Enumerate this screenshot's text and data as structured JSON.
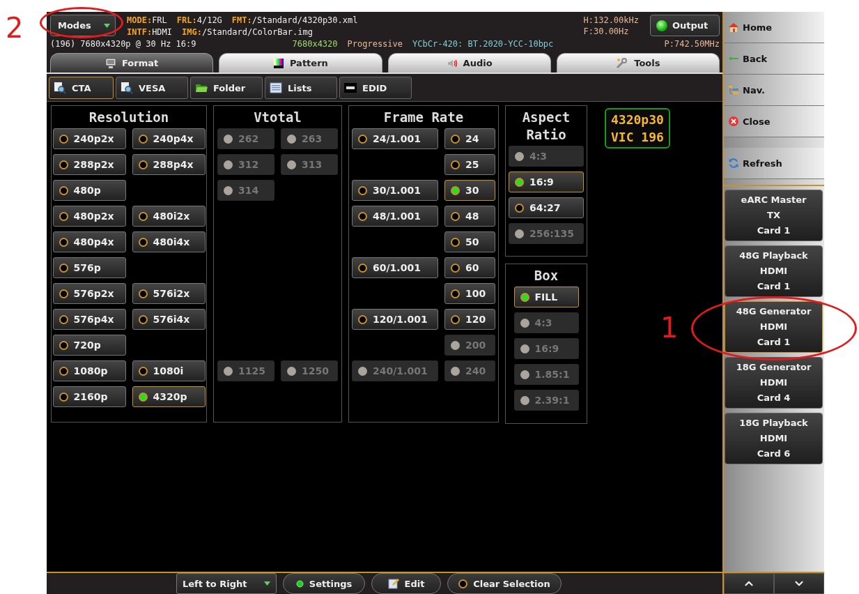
{
  "header": {
    "modes_button": "Modes",
    "info_line_1": [
      {
        "label": "MODE:",
        "value": "FRL"
      },
      {
        "label": "FRL:",
        "value": "4/12G"
      },
      {
        "label": "FMT:",
        "value": "/Standard/4320p30.xml"
      }
    ],
    "info_line_2": [
      {
        "label": "INTF:",
        "value": "HDMI"
      },
      {
        "label": "IMG:",
        "value": "/Standard/ColorBar.img"
      }
    ],
    "timing": "(196) 7680x4320p @ 30 Hz 16:9",
    "resolution": "7680x4320",
    "scan": "Progressive",
    "colorimetry": "YCbCr-420: BT.2020-YCC-10bpc",
    "h_freq": "H:132.00kHz",
    "f_rate": "F:30.00Hz",
    "pixel_clock": "P:742.50MHz",
    "output_button": {
      "label": "Output",
      "on": true
    }
  },
  "tabs": [
    {
      "label": "Format",
      "selected": true
    },
    {
      "label": "Pattern",
      "selected": false
    },
    {
      "label": "Audio",
      "selected": false
    },
    {
      "label": "Tools",
      "selected": false
    }
  ],
  "subtabs": [
    {
      "label": "CTA",
      "selected": true
    },
    {
      "label": "VESA",
      "selected": false
    },
    {
      "label": "Folder",
      "selected": false
    },
    {
      "label": "Lists",
      "selected": false
    },
    {
      "label": "EDID",
      "selected": false
    }
  ],
  "panels": [
    {
      "title": "Resolution",
      "kind": "grid",
      "rows": [
        {
          "left": {
            "label": "240p2x",
            "selected": false,
            "disabled": false
          },
          "right": {
            "label": "240p4x",
            "selected": false,
            "disabled": false
          }
        },
        {
          "left": {
            "label": "288p2x",
            "selected": false,
            "disabled": false
          },
          "right": {
            "label": "288p4x",
            "selected": false,
            "disabled": false
          }
        },
        {
          "left": {
            "label": "480p",
            "selected": false,
            "disabled": false
          }
        },
        {
          "left": {
            "label": "480p2x",
            "selected": false,
            "disabled": false
          },
          "right": {
            "label": "480i2x",
            "selected": false,
            "disabled": false
          }
        },
        {
          "left": {
            "label": "480p4x",
            "selected": false,
            "disabled": false
          },
          "right": {
            "label": "480i4x",
            "selected": false,
            "disabled": false
          }
        },
        {
          "left": {
            "label": "576p",
            "selected": false,
            "disabled": false
          }
        },
        {
          "left": {
            "label": "576p2x",
            "selected": false,
            "disabled": false
          },
          "right": {
            "label": "576i2x",
            "selected": false,
            "disabled": false
          }
        },
        {
          "left": {
            "label": "576p4x",
            "selected": false,
            "disabled": false
          },
          "right": {
            "label": "576i4x",
            "selected": false,
            "disabled": false
          }
        },
        {
          "left": {
            "label": "720p",
            "selected": false,
            "disabled": false
          }
        },
        {
          "left": {
            "label": "1080p",
            "selected": false,
            "disabled": false
          },
          "right": {
            "label": "1080i",
            "selected": false,
            "disabled": false
          }
        },
        {
          "left": {
            "label": "2160p",
            "selected": false,
            "disabled": false
          },
          "right": {
            "label": "4320p",
            "selected": true,
            "disabled": false
          }
        }
      ]
    },
    {
      "title": "Vtotal",
      "kind": "grid",
      "rows": [
        {
          "left": {
            "label": "262",
            "selected": false,
            "disabled": true
          },
          "right": {
            "label": "263",
            "selected": false,
            "disabled": true
          }
        },
        {
          "left": {
            "label": "312",
            "selected": false,
            "disabled": true
          },
          "right": {
            "label": "313",
            "selected": false,
            "disabled": true
          }
        },
        {
          "left": {
            "label": "314",
            "selected": false,
            "disabled": true
          }
        },
        {},
        {},
        {},
        {},
        {},
        {},
        {
          "left": {
            "label": "1125",
            "selected": false,
            "disabled": true
          },
          "right": {
            "label": "1250",
            "selected": false,
            "disabled": true
          }
        }
      ]
    },
    {
      "title": "Frame Rate",
      "kind": "grid",
      "rows": [
        {
          "left": {
            "label": "24/1.001",
            "selected": false,
            "disabled": false
          },
          "right": {
            "label": "24",
            "selected": false,
            "disabled": false
          }
        },
        {
          "right": {
            "label": "25",
            "selected": false,
            "disabled": false
          }
        },
        {
          "left": {
            "label": "30/1.001",
            "selected": false,
            "disabled": false
          },
          "right": {
            "label": "30",
            "selected": true,
            "disabled": false
          }
        },
        {
          "left": {
            "label": "48/1.001",
            "selected": false,
            "disabled": false
          },
          "right": {
            "label": "48",
            "selected": false,
            "disabled": false
          }
        },
        {
          "right": {
            "label": "50",
            "selected": false,
            "disabled": false
          }
        },
        {
          "left": {
            "label": "60/1.001",
            "selected": false,
            "disabled": false
          },
          "right": {
            "label": "60",
            "selected": false,
            "disabled": false
          }
        },
        {
          "right": {
            "label": "100",
            "selected": false,
            "disabled": false
          }
        },
        {
          "left": {
            "label": "120/1.001",
            "selected": false,
            "disabled": false
          },
          "right": {
            "label": "120",
            "selected": false,
            "disabled": false
          }
        },
        {
          "right": {
            "label": "200",
            "selected": false,
            "disabled": true
          }
        },
        {
          "left": {
            "label": "240/1.001",
            "selected": false,
            "disabled": true
          },
          "right": {
            "label": "240",
            "selected": false,
            "disabled": true
          }
        }
      ]
    },
    {
      "title": "Aspect Ratio",
      "kind": "list",
      "options": [
        {
          "label": "4:3",
          "selected": false,
          "disabled": true
        },
        {
          "label": "16:9",
          "selected": true,
          "disabled": false
        },
        {
          "label": "64:27",
          "selected": false,
          "disabled": false
        },
        {
          "label": "256:135",
          "selected": false,
          "disabled": true
        }
      ]
    },
    {
      "title": "Box",
      "kind": "list",
      "options": [
        {
          "label": "FILL",
          "selected": true,
          "disabled": false
        },
        {
          "label": "4:3",
          "selected": false,
          "disabled": true
        },
        {
          "label": "16:9",
          "selected": false,
          "disabled": true
        },
        {
          "label": "1.85:1",
          "selected": false,
          "disabled": true
        },
        {
          "label": "2.39:1",
          "selected": false,
          "disabled": true
        }
      ]
    }
  ],
  "format_badge": {
    "name": "4320p30",
    "vic": "VIC 196"
  },
  "bottom_bar": {
    "direction_dropdown": "Left to Right",
    "settings_button": "Settings",
    "edit_button": "Edit",
    "clear_button": "Clear Selection"
  },
  "sidebar": {
    "nav": [
      "Home",
      "Back",
      "Nav.",
      "Close",
      "Refresh"
    ],
    "cards": [
      {
        "lines": [
          "eARC Master",
          "TX",
          "Card 1"
        ],
        "selected": false
      },
      {
        "lines": [
          "48G Playback",
          "HDMI",
          "Card 1"
        ],
        "selected": false
      },
      {
        "lines": [
          "48G Generator",
          "HDMI",
          "Card 1"
        ],
        "selected": true
      },
      {
        "lines": [
          "18G Generator",
          "HDMI",
          "Card 4"
        ],
        "selected": false
      },
      {
        "lines": [
          "18G Playback",
          "HDMI",
          "Card 6"
        ],
        "selected": false
      }
    ]
  },
  "annotations": [
    "2",
    "1"
  ]
}
